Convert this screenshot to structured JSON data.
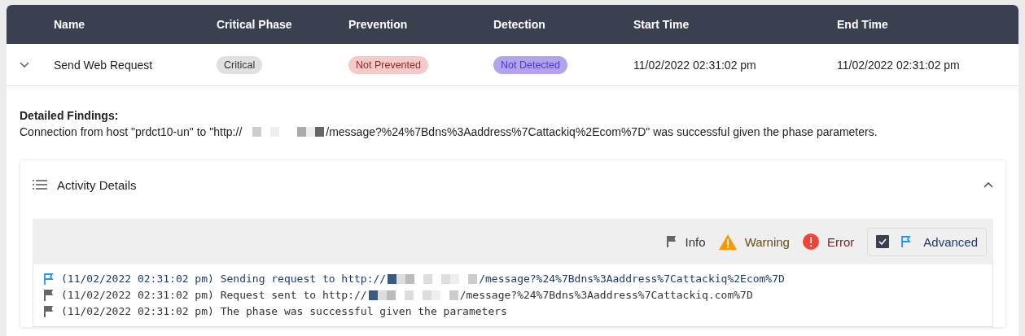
{
  "table": {
    "columns": [
      "Name",
      "Critical Phase",
      "Prevention",
      "Detection",
      "Start Time",
      "End Time"
    ],
    "rows": [
      {
        "expanded": true,
        "name": "Send Web Request",
        "badges": [
          {
            "kind": "neutral",
            "text": "Critical"
          },
          {
            "kind": "danger",
            "text": "Not Prevented"
          },
          {
            "kind": "purple",
            "text": "Not Detected"
          }
        ],
        "start_time": "11/02/2022 02:31:02 pm",
        "end_time": "11/02/2022 02:31:02 pm"
      }
    ]
  },
  "findings": {
    "title": "Detailed Findings:",
    "text_before": "Connection from host \"prdct10-un\" to \"http://",
    "text_after": "/message?%24%7Bdns%3Aaddress%7Cattackiq%2Ecom%7D\" was successful given the phase parameters."
  },
  "activity": {
    "title": "Activity Details",
    "expanded": true,
    "filters": [
      {
        "kind": "info",
        "label": "Info"
      },
      {
        "kind": "warning",
        "label": "Warning"
      },
      {
        "kind": "error",
        "label": "Error"
      },
      {
        "kind": "advanced",
        "label": "Advanced",
        "checked": true
      }
    ],
    "logs": [
      {
        "kind": "advanced",
        "text_before": "(11/02/2022 02:31:02 pm) Sending request to http://",
        "text_after": "/message?%24%7Bdns%3Aaddress%7Cattackiq%2Ecom%7D"
      },
      {
        "kind": "info",
        "text_before": "(11/02/2022 02:31:02 pm) Request sent to http://",
        "text_after": "/message?%24%7Bdns%3Aaddress%7Cattackiq.com%7D"
      },
      {
        "kind": "info",
        "text_before": "(11/02/2022 02:31:02 pm) The phase was successful given the parameters"
      }
    ]
  }
}
